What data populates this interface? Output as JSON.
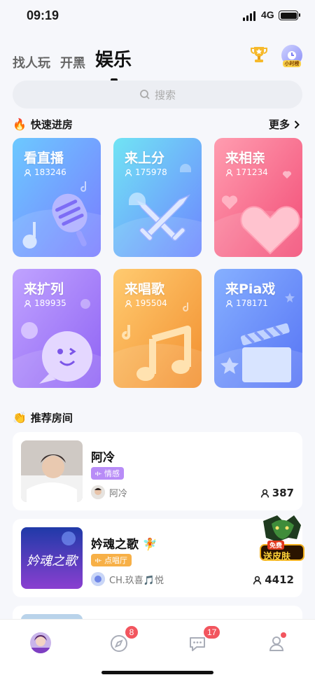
{
  "status_bar": {
    "time": "09:19",
    "network": "4G"
  },
  "top_tabs": [
    {
      "label": "找人玩",
      "active": false
    },
    {
      "label": "开黑",
      "active": false
    },
    {
      "label": "娱乐",
      "active": true
    }
  ],
  "header_icons": {
    "trophy": "trophy-icon",
    "clock_label": "小时榜"
  },
  "search": {
    "placeholder": "搜索"
  },
  "quick_section": {
    "title": "快速进房",
    "more_label": "更多"
  },
  "quick_rooms": [
    {
      "title": "看直播",
      "count": "183246",
      "gradient": [
        "#6cc9ff",
        "#7a8bff"
      ]
    },
    {
      "title": "来上分",
      "count": "175978",
      "gradient": [
        "#6ee0f6",
        "#6f8cff"
      ]
    },
    {
      "title": "来相亲",
      "count": "171234",
      "gradient": [
        "#ff98ad",
        "#f2557a"
      ]
    },
    {
      "title": "来扩列",
      "count": "189935",
      "gradient": [
        "#b79bff",
        "#9b6cf6"
      ]
    },
    {
      "title": "来唱歌",
      "count": "195504",
      "gradient": [
        "#ffc46b",
        "#f49735"
      ]
    },
    {
      "title": "来Pia戏",
      "count": "178171",
      "gradient": [
        "#7ea7ff",
        "#5a79f7"
      ]
    }
  ],
  "recommend_section": {
    "title": "推荐房间"
  },
  "rooms": [
    {
      "name": "阿冷",
      "tag": "情感",
      "tag_color": "#b88cf7",
      "host": "阿冷",
      "count": "387"
    },
    {
      "name": "妗魂之歌 🧚",
      "tag": "点唱厅",
      "tag_color": "#f7b047",
      "host": "CH.玖喜🎵悦",
      "count": "4412"
    }
  ],
  "promo": {
    "line1": "免费",
    "line2": "送皮肤"
  },
  "tabbar": [
    {
      "name": "home",
      "badge": ""
    },
    {
      "name": "discover",
      "badge": "8"
    },
    {
      "name": "messages",
      "badge": "17"
    },
    {
      "name": "profile",
      "badge": ""
    }
  ]
}
